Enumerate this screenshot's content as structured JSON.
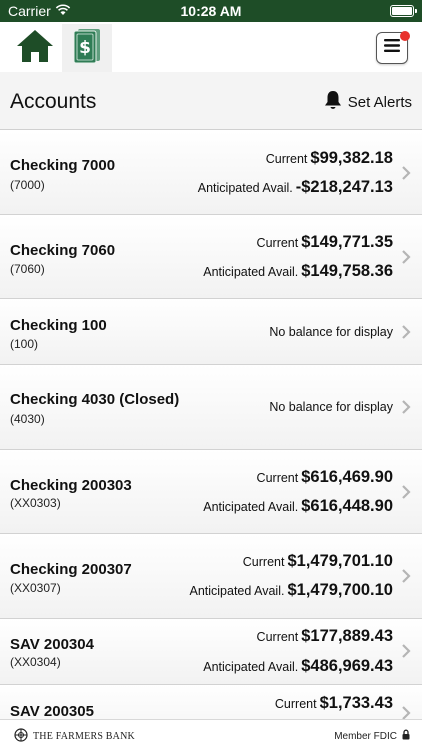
{
  "status_bar": {
    "carrier": "Carrier",
    "time": "10:28 AM"
  },
  "nav": {
    "home_icon": "home-icon",
    "dollar_icon": "dollar-bills-icon",
    "menu_icon": "hamburger-menu-icon",
    "brand_color": "#1e4d27"
  },
  "header": {
    "title": "Accounts",
    "alerts_label": "Set Alerts"
  },
  "accounts": [
    {
      "name": "Checking 7000",
      "number": "(7000)",
      "current_label": "Current",
      "current": "$99,382.18",
      "avail_label": "Anticipated Avail.",
      "avail": "-$218,247.13"
    },
    {
      "name": "Checking 7060",
      "number": "(7060)",
      "current_label": "Current",
      "current": "$149,771.35",
      "avail_label": "Anticipated Avail.",
      "avail": "$149,758.36"
    },
    {
      "name": "Checking 100",
      "number": "(100)",
      "no_balance": "No balance for display"
    },
    {
      "name": "Checking 4030 (Closed)",
      "number": "(4030)",
      "no_balance": "No balance for display"
    },
    {
      "name": "Checking 200303",
      "number": "(XX0303)",
      "current_label": "Current",
      "current": "$616,469.90",
      "avail_label": "Anticipated Avail.",
      "avail": "$616,448.90"
    },
    {
      "name": "Checking 200307",
      "number": "(XX0307)",
      "current_label": "Current",
      "current": "$1,479,701.10",
      "avail_label": "Anticipated Avail.",
      "avail": "$1,479,700.10"
    },
    {
      "name": "SAV 200304",
      "number": "(XX0304)",
      "current_label": "Current",
      "current": "$177,889.43",
      "avail_label": "Anticipated Avail.",
      "avail": "$486,969.43"
    },
    {
      "name": "SAV 200305",
      "current_label": "Current",
      "current": "$1,733.43"
    }
  ],
  "footer": {
    "bank_name": "THE FARMERS BANK",
    "fdic_label": "Member FDIC"
  }
}
